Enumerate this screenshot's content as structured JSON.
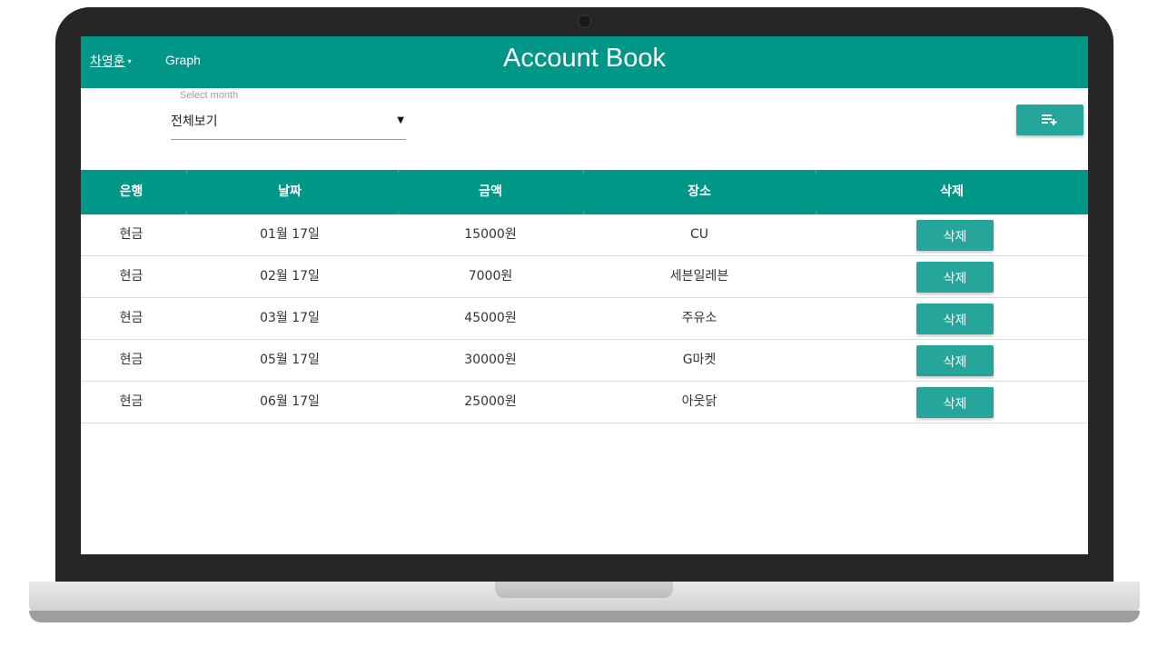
{
  "navbar": {
    "user_name": "차영훈",
    "user_caret": "▾",
    "graph_link": "Graph",
    "title": "Account Book"
  },
  "month_select": {
    "label": "Select month",
    "value": "전체보기"
  },
  "add_button": {
    "icon": "playlist-add-icon"
  },
  "table": {
    "headers": [
      "은행",
      "날짜",
      "금액",
      "장소",
      "삭제"
    ],
    "rows": [
      {
        "bank": "현금",
        "date": "01월 17일",
        "amount": "15000원",
        "place": "CU",
        "delete_label": "삭제"
      },
      {
        "bank": "현금",
        "date": "02월 17일",
        "amount": "7000원",
        "place": "세븐일레븐",
        "delete_label": "삭제"
      },
      {
        "bank": "현금",
        "date": "03월 17일",
        "amount": "45000원",
        "place": "주유소",
        "delete_label": "삭제"
      },
      {
        "bank": "현금",
        "date": "05월 17일",
        "amount": "30000원",
        "place": "G마켓",
        "delete_label": "삭제"
      },
      {
        "bank": "현금",
        "date": "06월 17일",
        "amount": "25000원",
        "place": "아웃닭",
        "delete_label": "삭제"
      }
    ]
  },
  "colors": {
    "primary": "#009688",
    "button": "#26a69a",
    "bezel": "#262626"
  }
}
